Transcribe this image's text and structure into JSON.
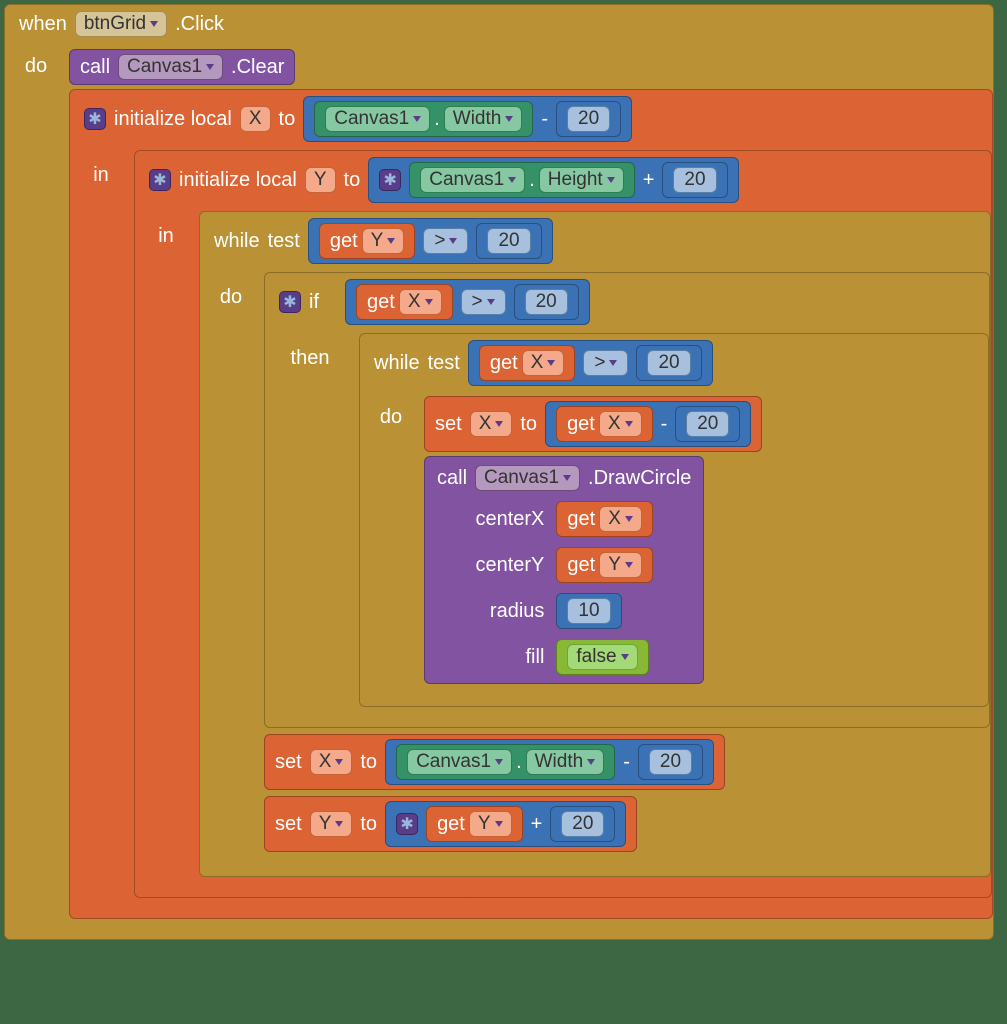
{
  "event": {
    "when": "when",
    "component": "btnGrid",
    "handler": ".Click",
    "do": "do"
  },
  "clear": {
    "call": "call",
    "component": "Canvas1",
    "method": ".Clear"
  },
  "initX": {
    "kw_initialize": "initialize local",
    "var": "X",
    "kw_to": "to",
    "in": "in",
    "expr": {
      "component": "Canvas1",
      "prop": "Width",
      "op": "-",
      "rhs": "20",
      "dot": "."
    }
  },
  "initY": {
    "kw_initialize": "initialize local",
    "var": "Y",
    "kw_to": "to",
    "in": "in",
    "expr": {
      "component": "Canvas1",
      "prop": "Height",
      "op": "+",
      "rhs": "20",
      "dot": "."
    }
  },
  "whileOuter": {
    "while": "while",
    "test": "test",
    "do": "do",
    "cond": {
      "get": "get",
      "var": "Y",
      "op": ">",
      "rhs": "20"
    }
  },
  "ifBlock": {
    "if": "if",
    "then": "then",
    "cond": {
      "get": "get",
      "var": "X",
      "op": ">",
      "rhs": "20"
    }
  },
  "whileInner": {
    "while": "while",
    "test": "test",
    "do": "do",
    "cond": {
      "get": "get",
      "var": "X",
      "op": ">",
      "rhs": "20"
    }
  },
  "setXdecr": {
    "set": "set",
    "var": "X",
    "to": "to",
    "expr": {
      "get": "get",
      "var": "X",
      "op": "-",
      "rhs": "20"
    }
  },
  "drawCircle": {
    "call": "call",
    "component": "Canvas1",
    "method": ".DrawCircle",
    "params": {
      "centerX": {
        "label": "centerX",
        "get": "get",
        "var": "X"
      },
      "centerY": {
        "label": "centerY",
        "get": "get",
        "var": "Y"
      },
      "radius": {
        "label": "radius",
        "value": "10"
      },
      "fill": {
        "label": "fill",
        "value": "false"
      }
    }
  },
  "setXreset": {
    "set": "set",
    "var": "X",
    "to": "to",
    "expr": {
      "component": "Canvas1",
      "prop": "Width",
      "op": "-",
      "rhs": "20",
      "dot": "."
    }
  },
  "setYincr": {
    "set": "set",
    "var": "Y",
    "to": "to",
    "expr": {
      "get": "get",
      "var": "Y",
      "op": "+",
      "rhs": "20"
    }
  }
}
